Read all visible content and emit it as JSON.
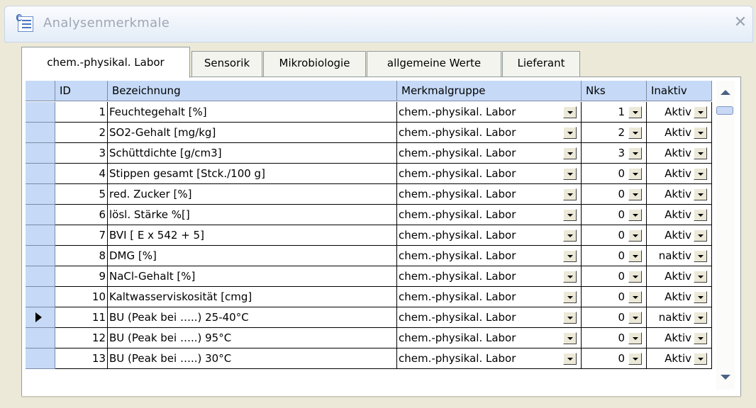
{
  "window": {
    "title": "Analysenmerkmale",
    "close_glyph": "✕"
  },
  "tabs": [
    {
      "label": "chem.-physikal. Labor",
      "active": true
    },
    {
      "label": "Sensorik"
    },
    {
      "label": "Mikrobiologie"
    },
    {
      "label": "allgemeine Werte"
    },
    {
      "label": "Lieferant"
    }
  ],
  "grid": {
    "columns": {
      "id": "ID",
      "bezeichnung": "Bezeichnung",
      "merkmalgruppe": "Merkmalgruppe",
      "nks": "Nks",
      "inaktiv": "Inaktiv"
    },
    "rows": [
      {
        "id": "1",
        "bezeichnung": "Feuchtegehalt [%]",
        "merkmalgruppe": "chem.-physikal. Labor",
        "nks": "1",
        "inaktiv": "Aktiv"
      },
      {
        "id": "2",
        "bezeichnung": "SO2-Gehalt [mg/kg]",
        "merkmalgruppe": "chem.-physikal. Labor",
        "nks": "2",
        "inaktiv": "Aktiv"
      },
      {
        "id": "3",
        "bezeichnung": "Schüttdichte [g/cm3]",
        "merkmalgruppe": "chem.-physikal. Labor",
        "nks": "3",
        "inaktiv": "Aktiv"
      },
      {
        "id": "4",
        "bezeichnung": "Stippen gesamt [Stck./100 g]",
        "merkmalgruppe": "chem.-physikal. Labor",
        "nks": "0",
        "inaktiv": "Aktiv"
      },
      {
        "id": "5",
        "bezeichnung": "red. Zucker  [%]",
        "merkmalgruppe": "chem.-physikal. Labor",
        "nks": "0",
        "inaktiv": "Aktiv"
      },
      {
        "id": "6",
        "bezeichnung": "lösl. Stärke %[]",
        "merkmalgruppe": "chem.-physikal. Labor",
        "nks": "0",
        "inaktiv": "Aktiv"
      },
      {
        "id": "7",
        "bezeichnung": "BVI [ E x 542 + 5]",
        "merkmalgruppe": "chem.-physikal. Labor",
        "nks": "0",
        "inaktiv": "Aktiv"
      },
      {
        "id": "8",
        "bezeichnung": "DMG [%]",
        "merkmalgruppe": "chem.-physikal. Labor",
        "nks": "0",
        "inaktiv": "naktiv"
      },
      {
        "id": "9",
        "bezeichnung": "NaCl-Gehalt [%]",
        "merkmalgruppe": "chem.-physikal. Labor",
        "nks": "0",
        "inaktiv": "Aktiv"
      },
      {
        "id": "10",
        "bezeichnung": "Kaltwasserviskosität [cmg]",
        "merkmalgruppe": "chem.-physikal. Labor",
        "nks": "0",
        "inaktiv": "Aktiv"
      },
      {
        "id": "11",
        "bezeichnung": "BU (Peak bei …..) 25-40°C",
        "merkmalgruppe": "chem.-physikal. Labor",
        "nks": "0",
        "inaktiv": "naktiv",
        "current": true
      },
      {
        "id": "12",
        "bezeichnung": "BU (Peak bei …..) 95°C",
        "merkmalgruppe": "chem.-physikal. Labor",
        "nks": "0",
        "inaktiv": "Aktiv"
      },
      {
        "id": "13",
        "bezeichnung": "BU (Peak bei …..) 30°C",
        "merkmalgruppe": "chem.-physikal. Labor",
        "nks": "0",
        "inaktiv": "Aktiv"
      }
    ]
  },
  "icons": {
    "app": "form-icon",
    "row_pointer": "row-pointer-icon"
  },
  "colors": {
    "header_bg": "#c6daf7",
    "window_bg": "#ece9d8"
  }
}
